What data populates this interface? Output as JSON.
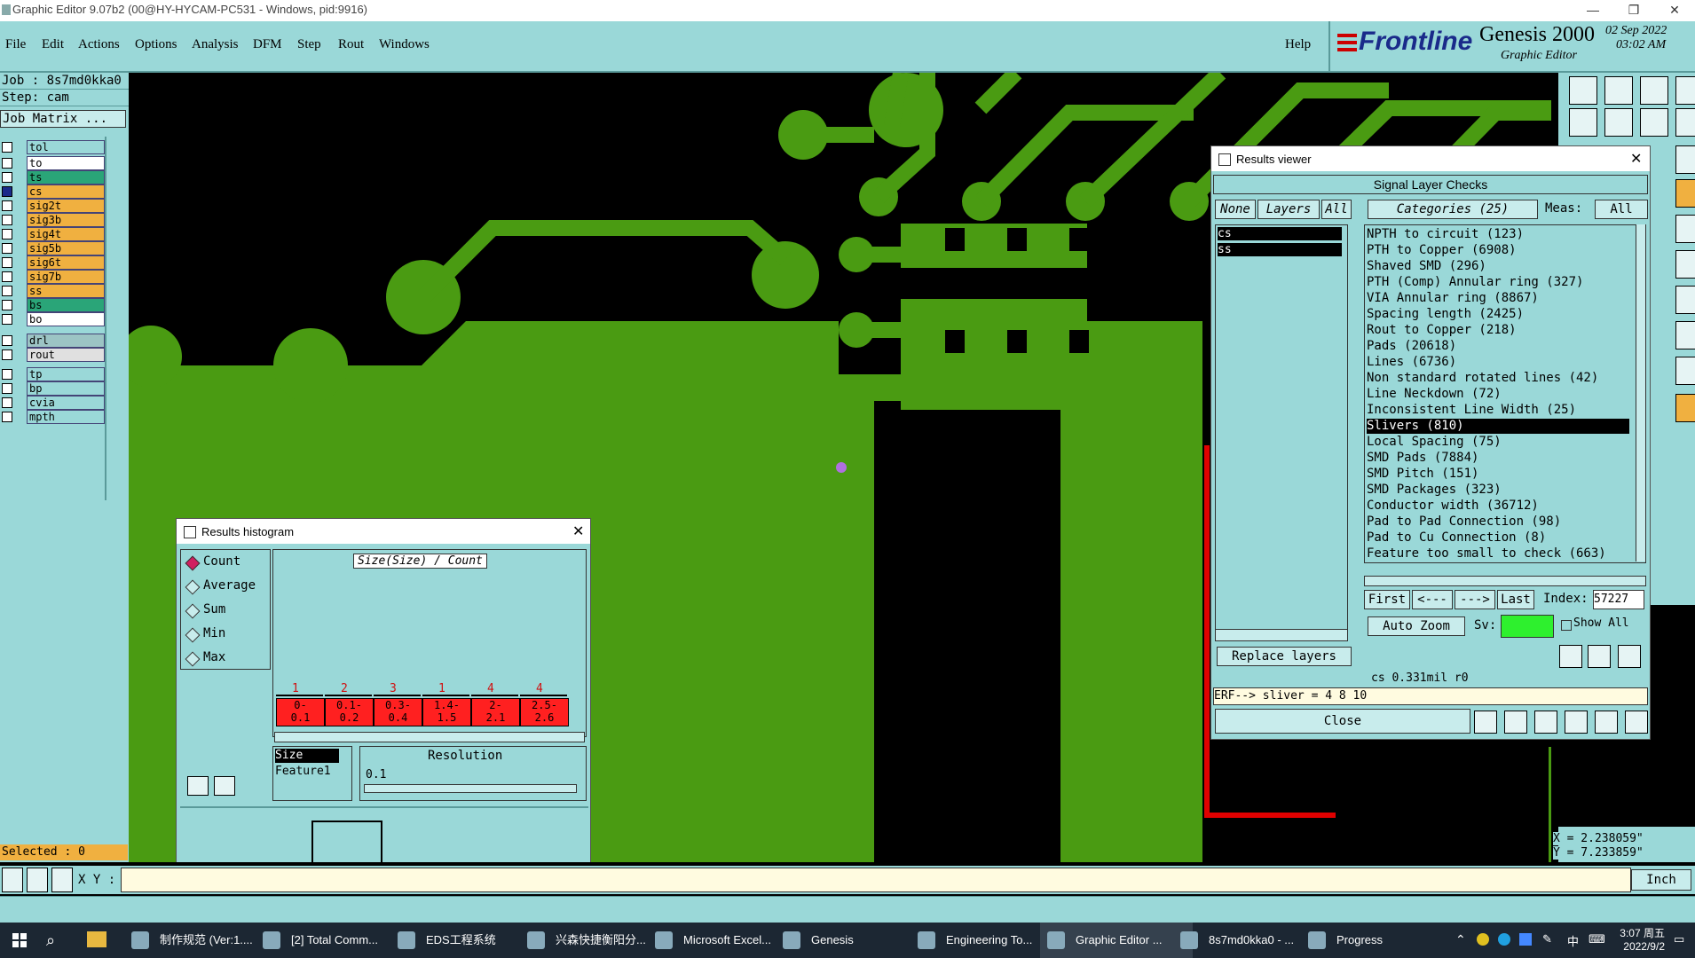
{
  "window": {
    "title": "Graphic Editor 9.07b2 (00@HY-HYCAM-PC531 - Windows, pid:9916)"
  },
  "menu": {
    "items": [
      "File",
      "Edit",
      "Actions",
      "Options",
      "Analysis",
      "DFM",
      "Step",
      "Rout",
      "Windows"
    ],
    "help": "Help"
  },
  "logo": {
    "brand": "Frontline",
    "product": "Genesis 2000",
    "subtitle": "Graphic Editor",
    "date": "02 Sep 2022",
    "time": "03:02 AM"
  },
  "left": {
    "job": "Job : 8s7md0kka0",
    "step": "Step: cam",
    "matrix": "Job Matrix ...",
    "layers": [
      {
        "name": "tol",
        "color": "#9ad8d8"
      },
      {
        "name": "to",
        "color": "#ffffff"
      },
      {
        "name": "ts",
        "color": "#2aa578"
      },
      {
        "name": "cs",
        "color": "#f0b040"
      },
      {
        "name": "sig2t",
        "color": "#f0b040"
      },
      {
        "name": "sig3b",
        "color": "#f0b040"
      },
      {
        "name": "sig4t",
        "color": "#f0b040"
      },
      {
        "name": "sig5b",
        "color": "#f0b040"
      },
      {
        "name": "sig6t",
        "color": "#f0b040"
      },
      {
        "name": "sig7b",
        "color": "#f0b040"
      },
      {
        "name": "ss",
        "color": "#f0b040"
      },
      {
        "name": "bs",
        "color": "#2aa578"
      },
      {
        "name": "bo",
        "color": "#ffffff"
      },
      {
        "name": "drl",
        "color": "#9cc4c4"
      },
      {
        "name": "rout",
        "color": "#e0e0e0"
      },
      {
        "name": "tp",
        "color": "#9ad8d8"
      },
      {
        "name": "bp",
        "color": "#9ad8d8"
      },
      {
        "name": "cvia",
        "color": "#9ad8d8"
      },
      {
        "name": "mpth",
        "color": "#9ad8d8"
      }
    ],
    "selected": "Selected : 0"
  },
  "coords": {
    "x": "X = 2.238059\"",
    "y": "Y = 7.233859\""
  },
  "status": {
    "xy_label": "X Y :",
    "unit": "Inch"
  },
  "results_viewer": {
    "title": "Results viewer",
    "header": "Signal Layer Checks",
    "none": "None",
    "layers": "Layers",
    "all": "All",
    "categories_label": "Categories (25)",
    "meas_label": "Meas:",
    "meas_value": "All",
    "layer_list": [
      "cs",
      "ss"
    ],
    "categories": [
      "NPTH to circuit (123)",
      "PTH to Copper (6908)",
      "Shaved SMD (296)",
      "PTH (Comp) Annular ring (327)",
      "VIA Annular ring (8867)",
      "Spacing length (2425)",
      "Rout to Copper (218)",
      "Pads (20618)",
      "Lines (6736)",
      "Non standard rotated lines (42)",
      "Line Neckdown (72)",
      "Inconsistent Line Width (25)",
      "Slivers (810)",
      "Local Spacing (75)",
      "SMD Pads (7884)",
      "SMD Pitch (151)",
      "SMD Packages (323)",
      "Conductor width (36712)",
      "Pad to Pad Connection (98)",
      "Pad to Cu Connection (8)",
      "Feature too small to check (663)"
    ],
    "selected_index": 12,
    "first": "First",
    "prev": "<---",
    "next": "--->",
    "last": "Last",
    "index_label": "Index:",
    "index_value": "57227",
    "auto_zoom": "Auto Zoom",
    "sv_label": "Sv:",
    "show_all": "Show All",
    "replace_layers": "Replace layers",
    "info": "cs  0.331mil  r0",
    "erf": "ERF--> sliver = 4 8 10",
    "close": "Close"
  },
  "histogram": {
    "title": "Results histogram",
    "modes": [
      "Count",
      "Average",
      "Sum",
      "Min",
      "Max"
    ],
    "selected_mode": "Count",
    "chart_title": "Size(Size) / Count",
    "counts": [
      "1",
      "2",
      "3",
      "1",
      "4",
      "4"
    ],
    "bins": [
      [
        "0-",
        "0.1"
      ],
      [
        "0.1-",
        "0.2"
      ],
      [
        "0.3-",
        "0.4"
      ],
      [
        "1.4-",
        "1.5"
      ],
      [
        "2-",
        "2.1"
      ],
      [
        "2.5-",
        "2.6"
      ]
    ],
    "list": [
      "Size",
      "Feature1"
    ],
    "resolution_label": "Resolution",
    "resolution_value": "0.1"
  },
  "taskbar": {
    "items": [
      "制作规范 (Ver:1....",
      "[2] Total Comm...",
      "EDS工程系统",
      "兴森快捷衡阳分...",
      "Microsoft Excel...",
      "Genesis",
      "Engineering To...",
      "Graphic Editor ...",
      "8s7md0kka0 - ...",
      "Progress"
    ],
    "time": "3:07 周五",
    "date": "2022/9/2",
    "ime": "中"
  },
  "colors": {
    "teal": "#9ad8d8",
    "copper": "#4a9b12",
    "highlight": "#000000",
    "bin_red": "#ff2020"
  }
}
